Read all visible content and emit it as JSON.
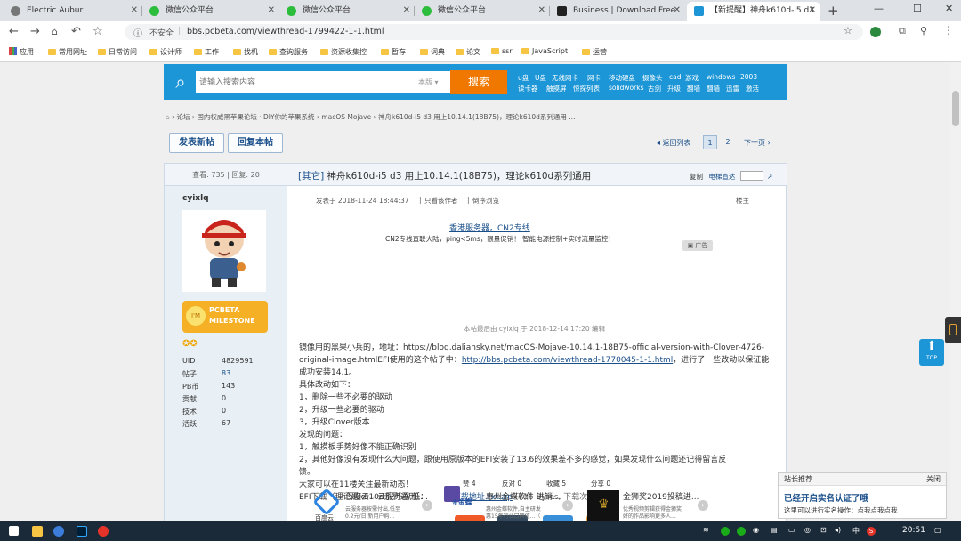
{
  "tabs": [
    {
      "title": "Electric Aubur",
      "color": "#666666"
    },
    {
      "title": "微信公众平台",
      "color": "#2dbd3d"
    },
    {
      "title": "微信公众平台",
      "color": "#2dbd3d"
    },
    {
      "title": "微信公众平台",
      "color": "#2dbd3d"
    },
    {
      "title": "Business | Download Free",
      "color": "#222222"
    },
    {
      "title": "【新提醒】神舟k610d-i5 d3",
      "color": "#1c96d6"
    }
  ],
  "toolbar": {
    "secure": "不安全",
    "url": "bbs.pcbeta.com/viewthread-1799422-1-1.html"
  },
  "bookmarks": [
    "应用",
    "常用网址",
    "日常访问",
    "设计师",
    "工作",
    "找机",
    "查询服务",
    "资源收集控",
    "暂存",
    "词典",
    "论文",
    "ssr",
    "JavaScript",
    "运营"
  ],
  "search": {
    "placeholder": "请输入搜索内容",
    "scope": "本版",
    "button": "搜索",
    "hot_row1": [
      "u盘",
      "U盘",
      "无线网卡",
      "网卡",
      "移动硬盘",
      "摄像头",
      "cad",
      "游戏",
      "windows",
      "2003"
    ],
    "hot_row2": [
      "读卡器",
      "触摸屏",
      "惊探列表",
      "solidworks",
      "古剑",
      "升级",
      "翻墙",
      "翻墙",
      "迅雷",
      "激活"
    ]
  },
  "breadcrumb": [
    "论坛",
    "国内权威黑苹果论坛 · DIY你的苹果系统",
    "macOS Mojave",
    "神舟k610d-i5 d3 用上10.14.1(18B75)，理论k610d系列通用 ..."
  ],
  "actions": {
    "new_post": "发表新帖",
    "reply": "回复本帖",
    "back": "返回列表",
    "pages": [
      "1",
      "2"
    ],
    "next": "下一页"
  },
  "post": {
    "stats": "查看: 735 | 回复: 20",
    "tag": "[其它]",
    "title": " 神舟k610d-i5 d3 用上10.14.1(18B75)，理论k610d系列通用",
    "copy": "复制",
    "jump": "电梯直达",
    "user": {
      "name": "cyixlq",
      "milestone1": "PCBETA",
      "milestone2": "MILESTONE",
      "labels": [
        "UID",
        "帖子",
        "PB币",
        "贡献",
        "技术",
        "活跃"
      ],
      "values": [
        "4829591",
        "83",
        "143",
        "0",
        "0",
        "67"
      ]
    },
    "published": "发表于 2018-11-24 18:44:37",
    "author_only": "只看该作者",
    "reverse": "倒序浏览",
    "floor": "楼主",
    "ad_link": "香港服务器，CN2专线",
    "ad_text": "CN2专线直联大陆，ping<5ms，限量促销！ 智能电源控制+实时流量监控！",
    "ad_badge": "广告",
    "edited": "本帖最后由 cyixlq 于 2018-12-14 17:20 编辑",
    "lines": [
      "镜像用的黑果小兵的，地址：https://blog.daliansky.net/macOS-Mojave-10.14.1-18B75-official-version-with-Clover-4726-",
      "original-image.htmlEFI使用的这个帖子中：",
      "http://bbs.pcbeta.com/viewthread-1770045-1-1.html",
      "，进行了一些改动以保证能",
      "成功安装14.1。",
      "具体改动如下：",
      "1，删除一些不必要的驱动",
      "2，升级一些必要的驱动",
      "3，升级Clover版本",
      "发现的问题：",
      "1，触摸板手势好像不能正确识别",
      "2，其他好像没有发现什么大问题，跟使用原版本的EFI安装了13.6的效果差不多的感觉，如果发现什么问题还记得留言反",
      "馈。",
      "大家可以在11楼关注最新动态！"
    ],
    "dl_label": "EFI下载（理论是k610d系列通用）：",
    "dl_link": "下载地址.txt.zip",
    "dl_info": " (716 Bytes, 下载次数: 47)",
    "reactions": [
      {
        "label": "赞 4",
        "color": "#f05a28",
        "icon": "thumbs-up"
      },
      {
        "label": "反对 0",
        "color": "#34495e",
        "icon": "thumbs-down"
      },
      {
        "label": "收藏 5",
        "color": "#3a8fd9",
        "icon": "star"
      },
      {
        "label": "分享 0",
        "color": "#f0a030",
        "icon": "share"
      }
    ]
  },
  "ads": [
    {
      "title": "百度云-- 云服务器,低...",
      "brand": "百度云",
      "desc1": "云服务器按需付出,低至",
      "desc2": "0.2元/日,新用户购..."
    },
    {
      "title": "惠州金蝶软件 进销...",
      "brand": "金蝶",
      "desc1": "惠州金蝶软件,自主研发",
      "desc2": "惠15年行业口碑值...（"
    },
    {
      "title": "金狮奖2019投稿进...",
      "brand": "",
      "desc1": "优秀视频剪辑获得金狮奖",
      "desc2": "好的作品影响更多人..."
    }
  ],
  "popup": {
    "head": "站长推荐",
    "close": "关闭",
    "title": "已经开启实名认证了哦",
    "body": "这里可以进行实名操作：点我点我点我"
  },
  "top_btn": "TOP",
  "taskbar": {
    "time": "20:51",
    "lang": "中",
    "ime": "S"
  }
}
